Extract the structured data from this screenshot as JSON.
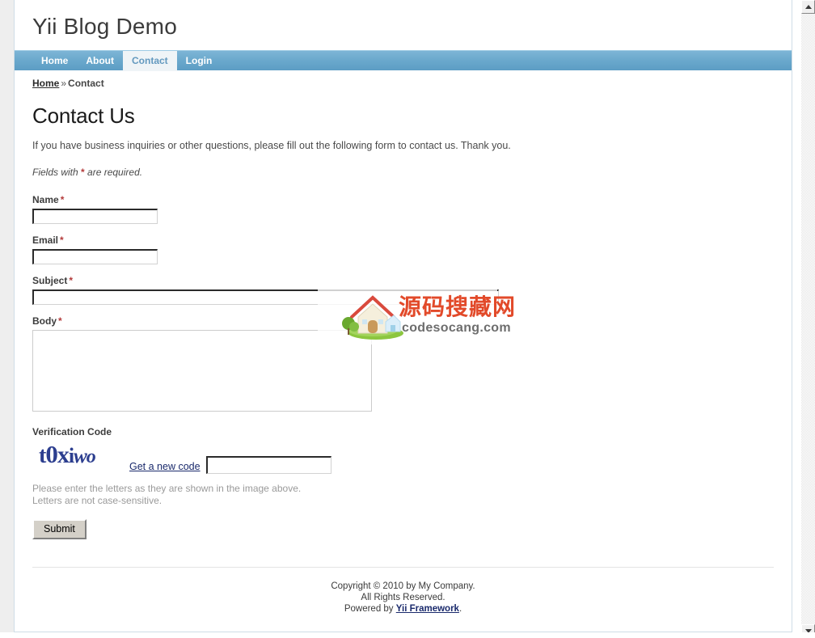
{
  "site": {
    "title": "Yii Blog Demo"
  },
  "nav": {
    "items": [
      {
        "label": "Home",
        "active": false
      },
      {
        "label": "About",
        "active": false
      },
      {
        "label": "Contact",
        "active": true
      },
      {
        "label": "Login",
        "active": false
      }
    ]
  },
  "breadcrumb": {
    "home_label": "Home",
    "separator": "»",
    "current": "Contact"
  },
  "main": {
    "page_title": "Contact Us",
    "intro": "If you have business inquiries or other questions, please fill out the following form to contact us. Thank you.",
    "required_note_prefix": "Fields with ",
    "required_mark": "*",
    "required_note_suffix": " are required."
  },
  "form": {
    "fields": [
      {
        "label": "Name",
        "required": true,
        "value": "",
        "placeholder": ""
      },
      {
        "label": "Email",
        "required": true,
        "value": "",
        "placeholder": ""
      },
      {
        "label": "Subject",
        "required": true,
        "value": "",
        "placeholder": ""
      },
      {
        "label": "Body",
        "required": true,
        "value": "",
        "placeholder": ""
      }
    ],
    "name_label": "Name",
    "email_label": "Email",
    "subject_label": "Subject",
    "body_label": "Body",
    "name_value": "",
    "email_value": "",
    "subject_value": "",
    "body_value": "",
    "verification_label": "Verification Code",
    "captcha_text": "toxiwo",
    "captcha_chars": [
      "t",
      "0",
      "x",
      "i",
      "w",
      "o"
    ],
    "captcha_value": "",
    "refresh_label": "Get a new code",
    "hint_line1": "Please enter the letters as they are shown in the image above.",
    "hint_line2": "Letters are not case-sensitive.",
    "submit_label": "Submit"
  },
  "footer": {
    "line1": "Copyright © 2010 by My Company.",
    "line2": "All Rights Reserved.",
    "powered_prefix": "Powered by ",
    "powered_link": "Yii Framework",
    "powered_suffix": "."
  },
  "watermark": {
    "chinese_text": "源码搜藏网",
    "url_text": "codesocang.com"
  },
  "colors": {
    "nav_blue": "#6aa8cc",
    "active_tab_bg": "#eff4f7",
    "active_tab_text": "#6399bf",
    "required_red": "#b33a3a",
    "link_blue": "#1a2a6c",
    "captcha_blue": "#2c3e8f",
    "watermark_red": "#e24a2a"
  }
}
